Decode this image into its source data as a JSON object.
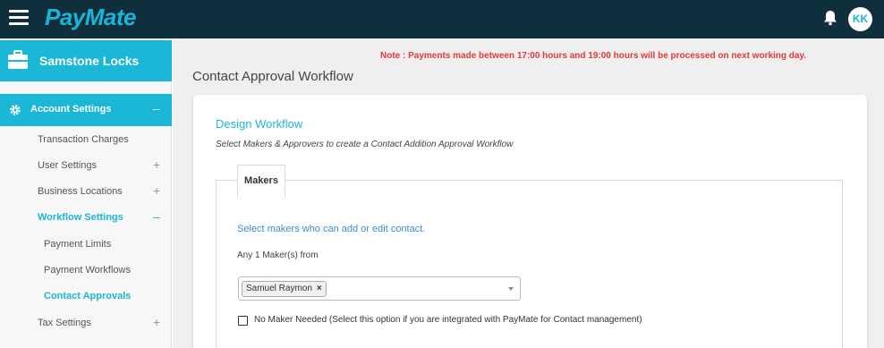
{
  "header": {
    "logo": "PayMate",
    "avatar_initials": "KK",
    "icons": {
      "menu": "hamburger-menu-icon",
      "notifications": "bell-icon"
    },
    "colors": {
      "topbar": "#0f2f3d",
      "accent": "#1bb7d7"
    }
  },
  "sidebar": {
    "company_name": "Samstone Locks",
    "account_settings": {
      "label": "Account Settings",
      "toggle": "–"
    },
    "items": [
      {
        "label": "Transaction Charges",
        "sign": ""
      },
      {
        "label": "User Settings",
        "sign": "+"
      },
      {
        "label": "Business Locations",
        "sign": "+"
      },
      {
        "label": "Workflow Settings",
        "sign": "–"
      },
      {
        "label": "Payment Limits",
        "sign": ""
      },
      {
        "label": "Payment Workflows",
        "sign": ""
      },
      {
        "label": "Contact Approvals",
        "sign": ""
      },
      {
        "label": "Tax Settings",
        "sign": "+"
      }
    ]
  },
  "main": {
    "note": "Note : Payments made between 17:00 hours and 19:00 hours will be processed on next working day.",
    "page_title": "Contact Approval Workflow",
    "card": {
      "heading": "Design Workflow",
      "subtext": "Select Makers & Approvers to create a Contact Addition Approval Workflow",
      "tab_label": "Makers",
      "select_description": "Select makers who can add or edit contact.",
      "any_label": "Any 1 Maker(s) from",
      "selected_maker": "Samuel Raymon",
      "checkbox_label": "No Maker Needed (Select this option if you are integrated with PayMate for Contact management)",
      "checkbox_checked": false
    }
  }
}
